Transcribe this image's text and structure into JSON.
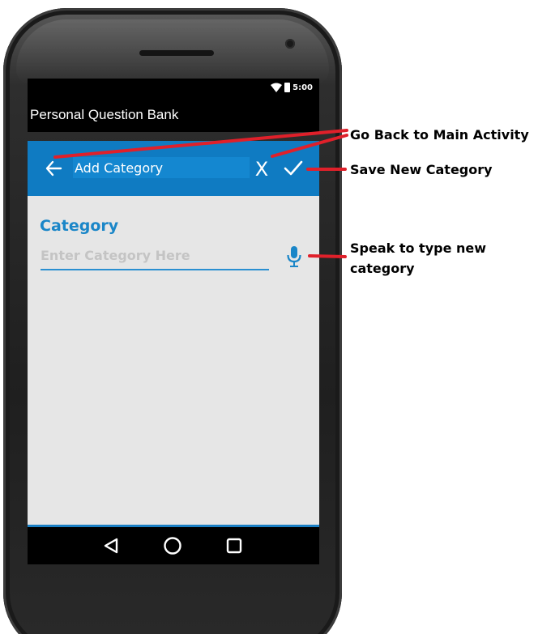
{
  "status_bar": {
    "time": "5:00"
  },
  "app": {
    "title": "Personal Question Bank"
  },
  "action_bar": {
    "title": "Add Category",
    "cancel_label": "X",
    "icons": {
      "back": "arrow-left-icon",
      "save": "checkmark-icon"
    }
  },
  "form": {
    "field_label": "Category",
    "input_value": "",
    "input_placeholder": "Enter Category Here",
    "mic_icon": "microphone-icon"
  },
  "nav_bar": {
    "icons": [
      "back-triangle-icon",
      "home-circle-icon",
      "recents-square-icon"
    ]
  },
  "annotations": {
    "go_back": "Go Back to Main Activity",
    "save_new": "Save New Category",
    "speak_line1": "Speak to type new",
    "speak_line2": "category"
  },
  "colors": {
    "action_bar": "#0f7bc2",
    "accent": "#1a86c8",
    "annotation_line": "#e0202a",
    "content_bg": "#e6e6e6"
  }
}
